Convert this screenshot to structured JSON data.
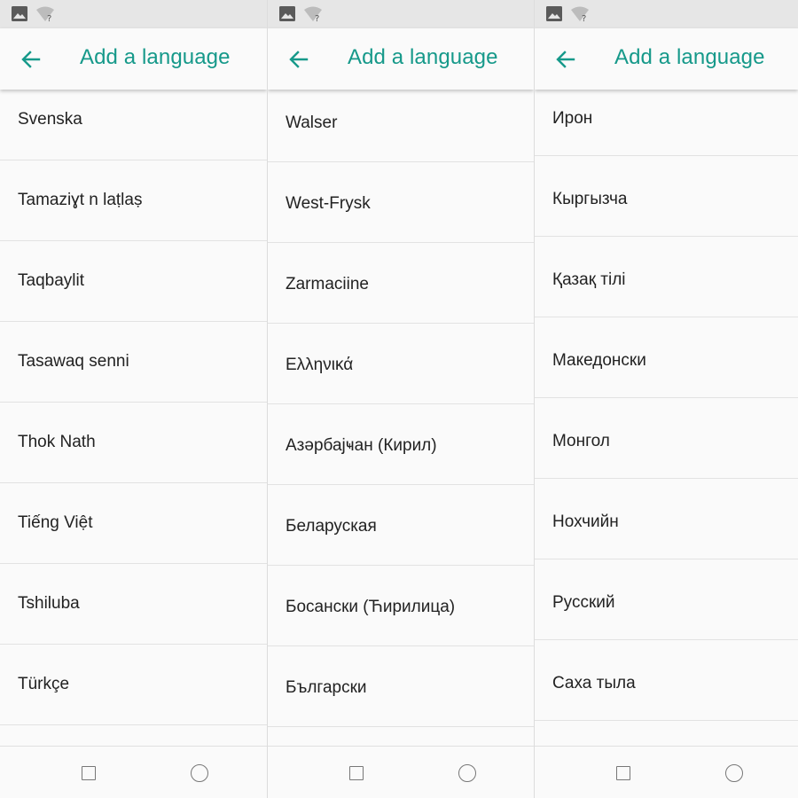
{
  "title": "Add a language",
  "icons": {
    "status_image": "image-icon",
    "status_wifi": "wifi-question-icon",
    "back": "arrow-left-icon",
    "nav_recents": "square-icon",
    "nav_home": "circle-icon"
  },
  "colors": {
    "accent": "#16998a",
    "status_bar": "#e6e6e6",
    "background": "#fafafa",
    "text": "#222222"
  },
  "panels": [
    {
      "items": [
        "Svenska",
        "Tamaziɣt n laṭlaṣ",
        "Taqbaylit",
        "Tasawaq senni",
        "Thok Nath",
        "Tiếng Việt",
        "Tshiluba",
        "Türkçe"
      ]
    },
    {
      "items": [
        "Walser",
        "West-Frysk",
        "Zarmaciine",
        "Ελληνικά",
        "Азәрбајҹан (Кирил)",
        "Беларуская",
        "Босански (Ћирилица)",
        "Български"
      ]
    },
    {
      "items": [
        "Ирон",
        "Кыргызча",
        "Қазақ тілі",
        "Македонски",
        "Монгол",
        "Нохчийн",
        "Русский",
        "Саха тыла"
      ]
    }
  ]
}
